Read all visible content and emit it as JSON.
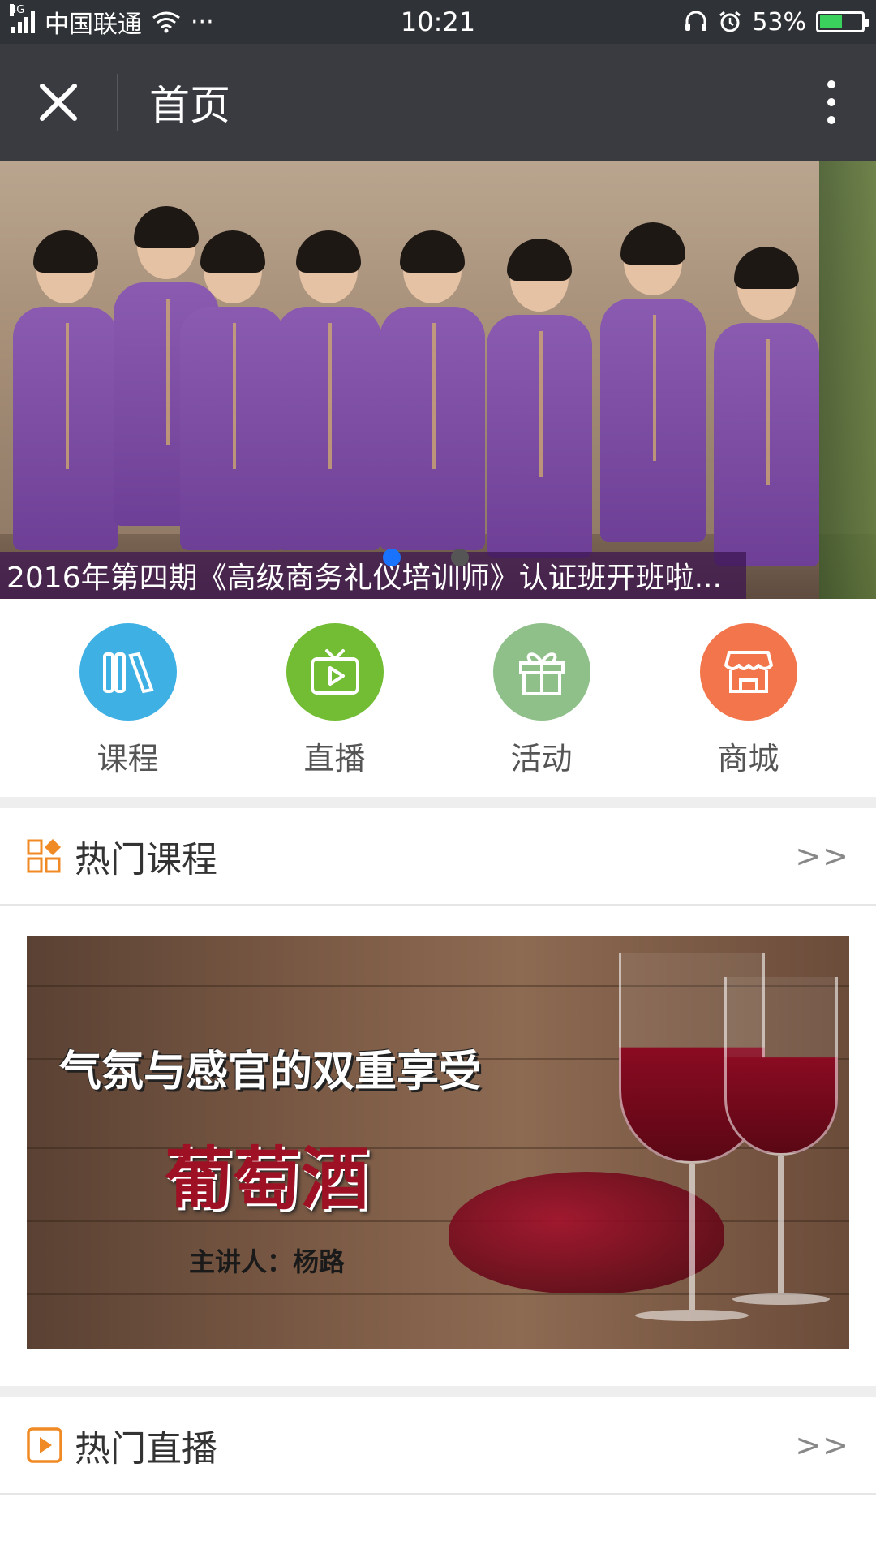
{
  "status_bar": {
    "network_type": "4G",
    "carrier": "中国联通",
    "more": "···",
    "time": "10:21",
    "battery_percent": "53%",
    "battery_level": 0.53,
    "battery_color": "#3bd15d"
  },
  "title_bar": {
    "close_icon": "close-icon",
    "title": "首页",
    "more_icon": "more-vertical-icon"
  },
  "banner": {
    "caption": "2016年第四期《高级商务礼仪培训师》认证班开班啦...",
    "active_dot_color": "#1a73ff",
    "inactive_dot_color": "#555555"
  },
  "quick_nav": [
    {
      "label": "课程",
      "icon": "books-icon",
      "color": "#3fb0e4"
    },
    {
      "label": "直播",
      "icon": "tv-icon",
      "color": "#72bd34"
    },
    {
      "label": "活动",
      "icon": "gift-icon",
      "color": "#8fc08a"
    },
    {
      "label": "商城",
      "icon": "store-icon",
      "color": "#f2754c"
    }
  ],
  "hot_courses": {
    "title": "热门课程",
    "more": ">>",
    "icon": "grid-icon",
    "card": {
      "subtitle": "气氛与感官的双重享受",
      "main_title": "葡萄酒",
      "speaker": "主讲人：杨路"
    }
  },
  "hot_live": {
    "title": "热门直播",
    "more": ">>",
    "icon": "play-icon"
  },
  "accent_color": "#f08a24"
}
